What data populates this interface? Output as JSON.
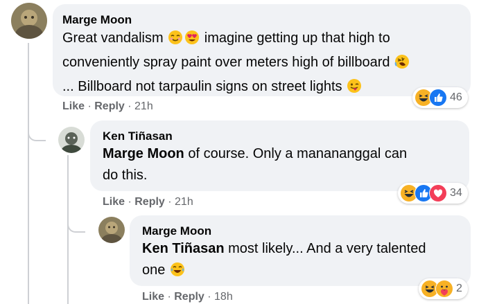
{
  "comments": [
    {
      "author": "Marge Moon",
      "text_1": "Great vandalism",
      "text_2": "imagine getting up that high to",
      "text_3": "conveniently spray paint over meters high of billboard",
      "text_4": "... Billboard not tarpaulin signs on street lights",
      "actions": {
        "like": "Like",
        "sep": " · ",
        "reply": "Reply",
        "time": " · 21h"
      },
      "reactions": {
        "count": "46",
        "icons": [
          "laugh-icon",
          "like-icon"
        ]
      }
    },
    {
      "author": "Ken Tiñasan",
      "mention": "Marge Moon",
      "text_1": " of course. Only a manananggal can",
      "text_2": "do this.",
      "actions": {
        "like": "Like",
        "sep": " · ",
        "reply": "Reply",
        "time": " · 21h"
      },
      "reactions": {
        "count": "34",
        "icons": [
          "laugh-icon",
          "like-icon",
          "love-icon"
        ]
      }
    },
    {
      "author": "Marge Moon",
      "mention": "Ken Tiñasan",
      "text_1": " most likely... And a very talented",
      "text_2": "one",
      "actions": {
        "like": "Like",
        "sep": " · ",
        "reply": "Reply",
        "time": " · 18h"
      },
      "reactions": {
        "count": "2",
        "icons": [
          "laugh-icon",
          "care-icon"
        ]
      }
    }
  ],
  "colors": {
    "bubble": "#f0f2f5",
    "meta": "#65676b",
    "like": "#1877f2",
    "love": "#f33e58",
    "haha": "#f7b125"
  }
}
